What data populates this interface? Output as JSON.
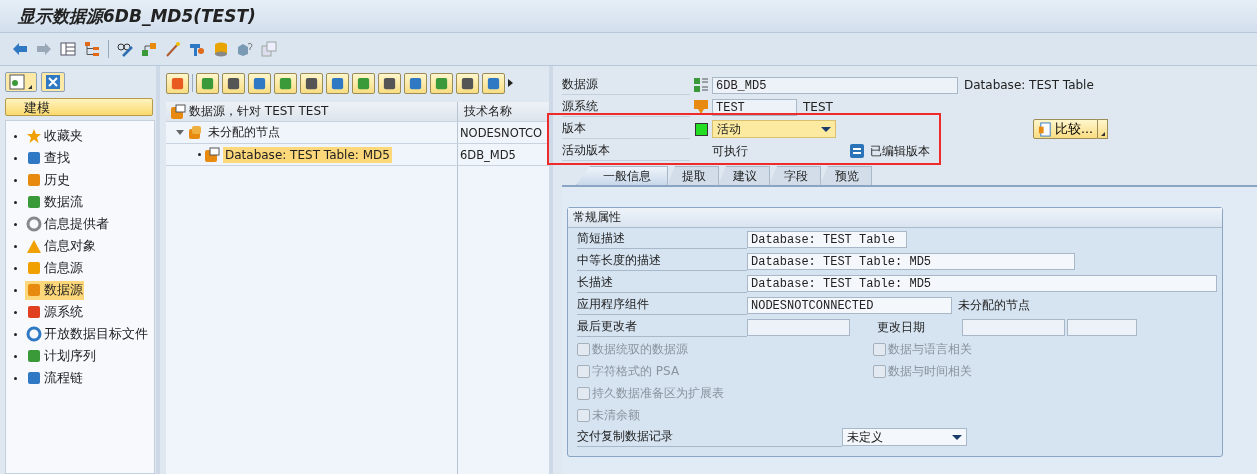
{
  "window": {
    "title": "显示数据源6DB_MD5(TEST)"
  },
  "sidebar": {
    "header": "建模",
    "items": [
      {
        "label": "收藏夹",
        "selected": false
      },
      {
        "label": "查找",
        "selected": false
      },
      {
        "label": "历史",
        "selected": false
      },
      {
        "label": "数据流",
        "selected": false
      },
      {
        "label": "信息提供者",
        "selected": false
      },
      {
        "label": "信息对象",
        "selected": false
      },
      {
        "label": "信息源",
        "selected": false
      },
      {
        "label": "数据源",
        "selected": true
      },
      {
        "label": "源系统",
        "selected": false
      },
      {
        "label": "开放数据目标文件",
        "selected": false
      },
      {
        "label": "计划序列",
        "selected": false
      },
      {
        "label": "流程链",
        "selected": false
      }
    ]
  },
  "tree": {
    "columns": [
      "数据源，针对 TEST TEST",
      "技术名称"
    ],
    "rows": [
      {
        "label": "未分配的节点",
        "tech_name": "NODESNOTCO",
        "expanded": true,
        "selected": false,
        "children": [
          {
            "label": "Database: TEST Table: MD5",
            "tech_name": "6DB_MD5",
            "selected": true
          }
        ]
      }
    ]
  },
  "header": {
    "datasource": {
      "label": "数据源",
      "value": "6DB_MD5",
      "description": "Database: TEST Table"
    },
    "source_system": {
      "label": "源系统",
      "value": "TEST",
      "description": "TEST"
    },
    "version": {
      "label": "版本",
      "value": "活动"
    },
    "active_version": {
      "label": "活动版本",
      "value": "可执行",
      "status": "已编辑版本"
    },
    "compare_button": "比较..."
  },
  "tabs": [
    {
      "label": "一般信息",
      "selected": true
    },
    {
      "label": "提取",
      "selected": false
    },
    {
      "label": "建议",
      "selected": false
    },
    {
      "label": "字段",
      "selected": false
    },
    {
      "label": "预览",
      "selected": false
    }
  ],
  "general": {
    "title": "常规属性",
    "short_description": {
      "label": "简短描述",
      "value": "Database: TEST Table"
    },
    "medium_description": {
      "label": "中等长度的描述",
      "value": "Database: TEST Table: MD5"
    },
    "long_description": {
      "label": "长描述",
      "value": "Database: TEST Table: MD5"
    },
    "application_component": {
      "label": "应用程序组件",
      "value": "NODESNOTCONNECTED",
      "description": "未分配的节点"
    },
    "last_changed_by": {
      "label": "最后更改者"
    },
    "changed_on": {
      "label": "更改日期"
    },
    "options_left": [
      {
        "label": "数据统驭的数据源",
        "checked": false,
        "disabled": true
      },
      {
        "label": "字符格式的 PSA",
        "checked": false,
        "disabled": true
      },
      {
        "label": "持久数据准备区为扩展表",
        "checked": false,
        "disabled": true
      },
      {
        "label": "未清余额",
        "checked": false,
        "disabled": true
      }
    ],
    "options_right": [
      {
        "label": "数据与语言相关",
        "checked": false,
        "disabled": true
      },
      {
        "label": "数据与时间相关",
        "checked": false,
        "disabled": true
      }
    ],
    "delivery": {
      "label": "交付复制数据记录",
      "value": "未定义"
    }
  }
}
